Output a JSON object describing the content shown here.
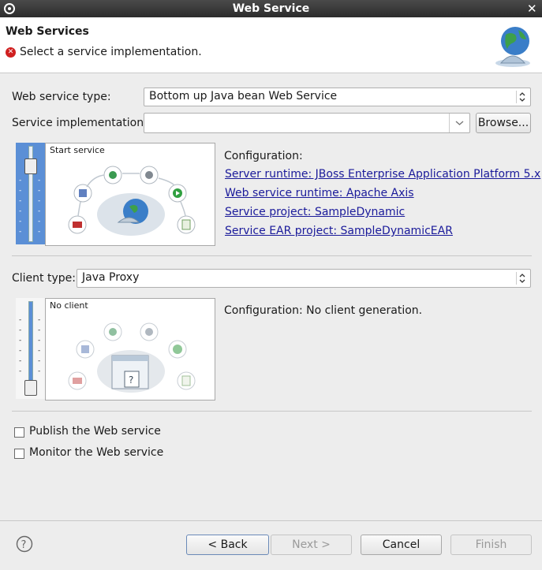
{
  "window": {
    "title": "Web Service"
  },
  "header": {
    "title": "Web Services",
    "message": "Select a service implementation."
  },
  "service": {
    "type_label": "Web service type:",
    "type_value": "Bottom up Java bean Web Service",
    "impl_label": "Service implementation:",
    "impl_value": "",
    "browse_label": "Browse...",
    "slider_caption": "Start service",
    "config_label": "Configuration:",
    "links": [
      "Server runtime: JBoss Enterprise Application Platform 5.x",
      "Web service runtime: Apache Axis",
      "Service project: SampleDynamic",
      "Service EAR project: SampleDynamicEAR"
    ]
  },
  "client": {
    "type_label": "Client type:",
    "type_value": "Java Proxy",
    "slider_caption": "No client",
    "config_text": "Configuration: No client generation."
  },
  "options": {
    "publish_label": "Publish the Web service",
    "publish_checked": false,
    "monitor_label": "Monitor the Web service",
    "monitor_checked": false
  },
  "footer": {
    "back": "< Back",
    "next": "Next >",
    "cancel": "Cancel",
    "finish": "Finish"
  },
  "colors": {
    "link": "#1a1a9a",
    "error": "#d02020",
    "slider_blue": "#5b8fd6"
  }
}
